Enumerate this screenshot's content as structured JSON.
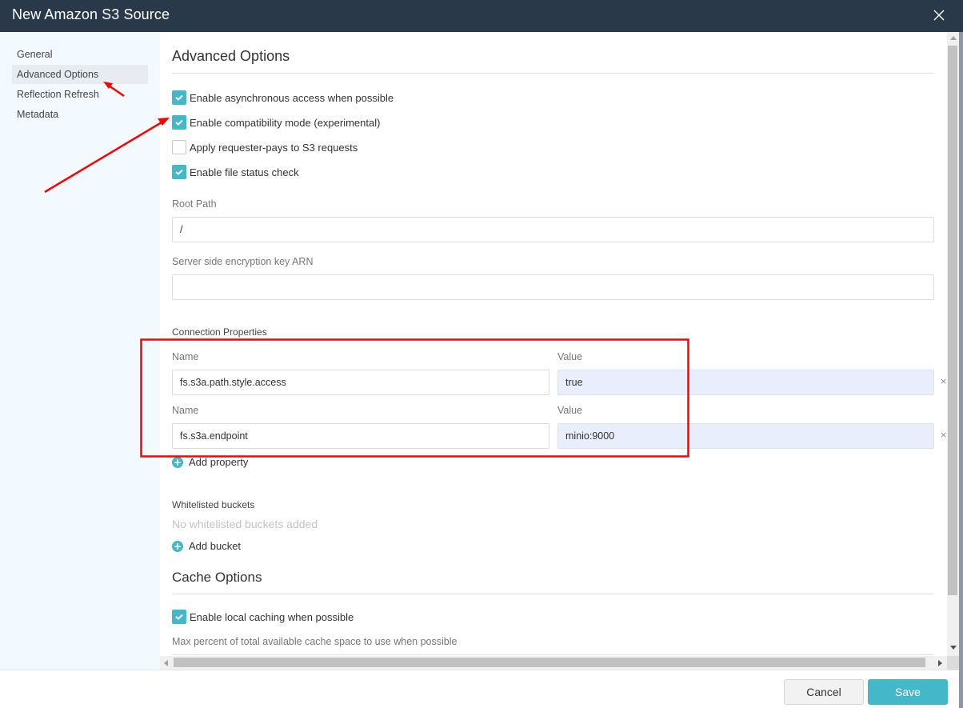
{
  "dialog": {
    "title": "New Amazon S3 Source",
    "close_icon": "close-icon"
  },
  "sidebar": {
    "items": [
      {
        "label": "General",
        "active": false
      },
      {
        "label": "Advanced Options",
        "active": true
      },
      {
        "label": "Reflection Refresh",
        "active": false
      },
      {
        "label": "Metadata",
        "active": false
      }
    ]
  },
  "advanced": {
    "heading": "Advanced Options",
    "checkboxes": [
      {
        "label": "Enable asynchronous access when possible",
        "checked": true
      },
      {
        "label": "Enable compatibility mode (experimental)",
        "checked": true
      },
      {
        "label": "Apply requester-pays to S3 requests",
        "checked": false
      },
      {
        "label": "Enable file status check",
        "checked": true
      }
    ],
    "root_path": {
      "label": "Root Path",
      "value": "/"
    },
    "encryption_key": {
      "label": "Server side encryption key ARN",
      "value": ""
    },
    "connection_properties": {
      "label": "Connection Properties",
      "name_label": "Name",
      "value_label": "Value",
      "rows": [
        {
          "name": "fs.s3a.path.style.access",
          "value": "true"
        },
        {
          "name": "fs.s3a.endpoint",
          "value": "minio:9000"
        }
      ],
      "remove_icon": "×",
      "add_label": "Add property"
    },
    "whitelisted_buckets": {
      "label": "Whitelisted buckets",
      "empty_text": "No whitelisted buckets added",
      "add_label": "Add bucket"
    }
  },
  "cache": {
    "heading": "Cache Options",
    "checkbox": {
      "label": "Enable local caching when possible",
      "checked": true
    },
    "max_percent_label": "Max percent of total available cache space to use when possible"
  },
  "footer": {
    "cancel_label": "Cancel",
    "save_label": "Save"
  },
  "colors": {
    "titlebar": "#2a394a",
    "accent": "#43b8c9",
    "annotation": "#ff0000"
  }
}
